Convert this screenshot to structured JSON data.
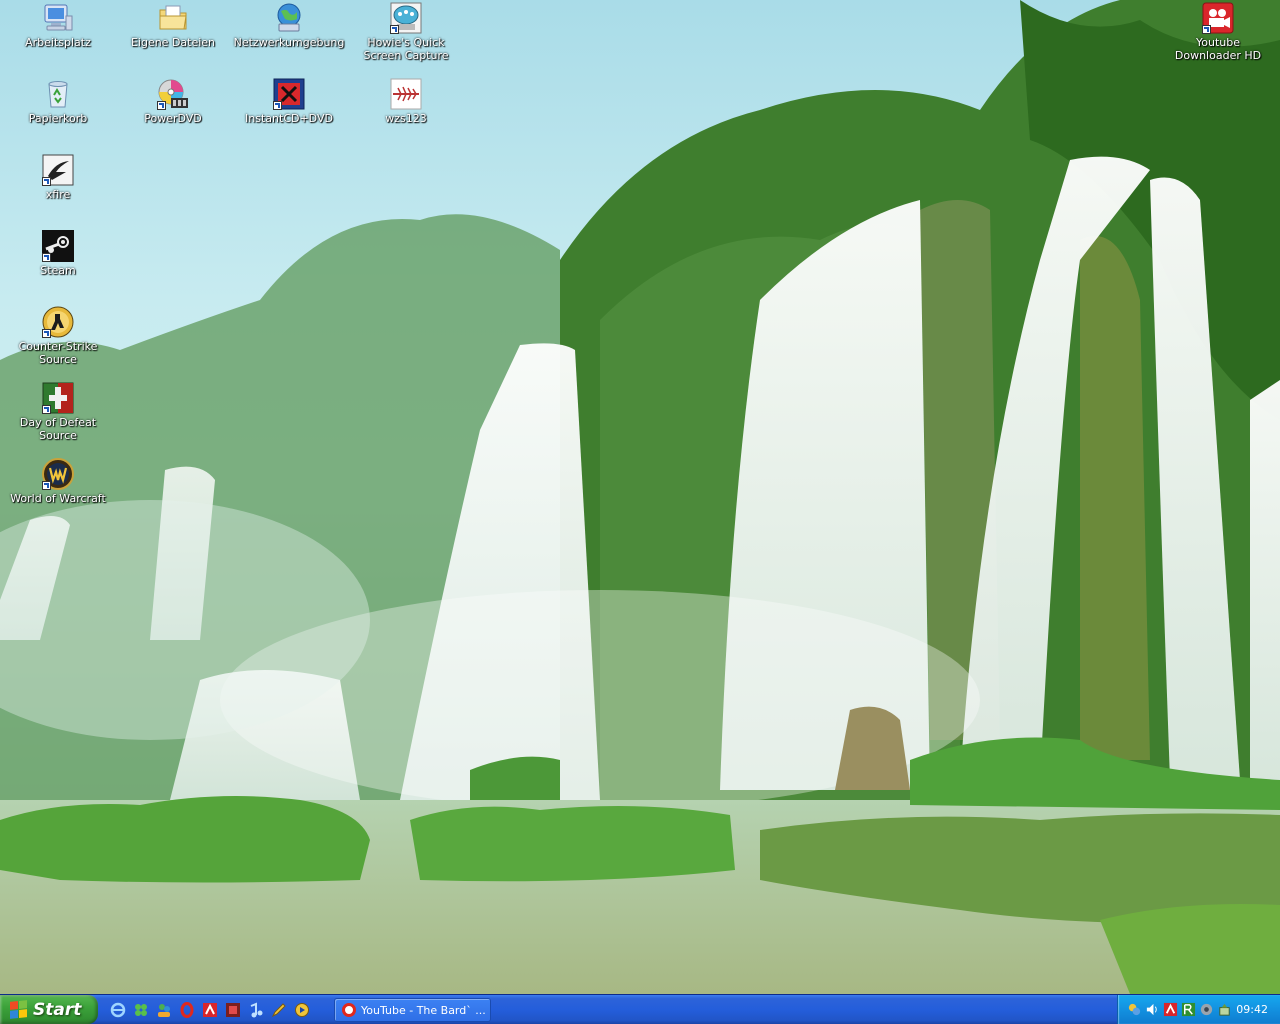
{
  "desktop": {
    "icons": [
      {
        "label": "Arbeitsplatz",
        "icon": "my-computer-icon"
      },
      {
        "label": "Eigene Dateien",
        "icon": "my-documents-icon"
      },
      {
        "label": "Netzwerkumgebung",
        "icon": "network-places-icon"
      },
      {
        "label": "Howie's Quick Screen Capture",
        "icon": "screen-capture-icon"
      },
      {
        "label": "Youtube Downloader HD",
        "icon": "youtube-downloader-icon"
      },
      {
        "label": "Papierkorb",
        "icon": "recycle-bin-icon"
      },
      {
        "label": "PowerDVD",
        "icon": "powerdvd-icon"
      },
      {
        "label": "InstantCD+DVD",
        "icon": "instantcd-icon"
      },
      {
        "label": "wzs123",
        "icon": "wzs123-icon"
      },
      {
        "label": "xfire",
        "icon": "xfire-icon"
      },
      {
        "label": "Steam",
        "icon": "steam-icon"
      },
      {
        "label": "Counter-Strike Source",
        "icon": "counter-strike-icon"
      },
      {
        "label": "Day of Defeat Source",
        "icon": "day-of-defeat-icon"
      },
      {
        "label": "World of Warcraft",
        "icon": "world-of-warcraft-icon"
      }
    ]
  },
  "taskbar": {
    "start_label": "Start",
    "quick_launch": [
      "internet-explorer-icon",
      "messenger-icon",
      "msn-icon",
      "opera-icon",
      "antivir-icon",
      "app-icon",
      "media-player-icon",
      "pen-icon",
      "winamp-icon"
    ],
    "task_buttons": [
      {
        "label": "YouTube - The Bard` ...",
        "icon": "opera-icon"
      }
    ],
    "tray_icons": [
      "network-icon",
      "volume-icon",
      "antivir-tray-icon",
      "rk-icon",
      "settings-tray-icon",
      "safely-remove-icon"
    ],
    "clock": "09:42"
  },
  "colors": {
    "taskbar_blue": "#245edb",
    "start_green": "#3da33b",
    "tray_blue": "#1391e0"
  }
}
